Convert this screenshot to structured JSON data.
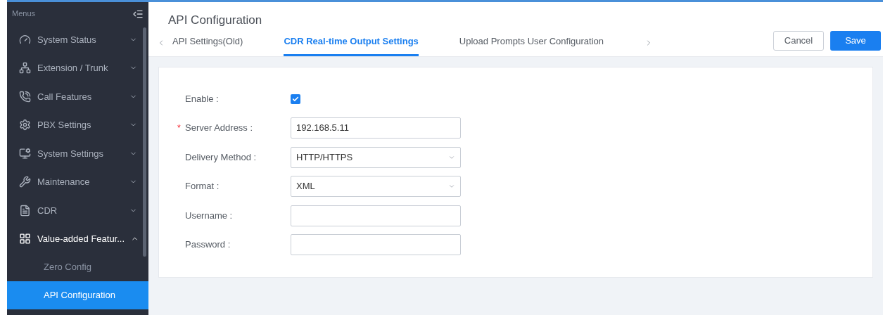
{
  "sidebar": {
    "title": "Menus",
    "items": [
      {
        "label": "System Status",
        "expanded": false
      },
      {
        "label": "Extension / Trunk",
        "expanded": false
      },
      {
        "label": "Call Features",
        "expanded": false
      },
      {
        "label": "PBX Settings",
        "expanded": false
      },
      {
        "label": "System Settings",
        "expanded": false
      },
      {
        "label": "Maintenance",
        "expanded": false
      },
      {
        "label": "CDR",
        "expanded": false
      },
      {
        "label": "Value-added Featur...",
        "expanded": true,
        "children": [
          {
            "label": "Zero Config",
            "selected": false
          },
          {
            "label": "API Configuration",
            "selected": true
          }
        ]
      }
    ]
  },
  "page": {
    "title": "API Configuration"
  },
  "tabs": [
    {
      "label": "API Settings(Old)",
      "selected": false
    },
    {
      "label": "CDR Real-time Output Settings",
      "selected": true
    },
    {
      "label": "Upload Prompts User Configuration",
      "selected": false
    }
  ],
  "buttons": [
    {
      "label": "Cancel",
      "kind": "secondary"
    },
    {
      "label": "Save",
      "kind": "primary"
    }
  ],
  "form": [
    {
      "label": "Enable :",
      "kind": "checkbox",
      "checked": true
    },
    {
      "label": "Server Address :",
      "kind": "text",
      "value": "192.168.5.11",
      "required_mark": "*"
    },
    {
      "label": "Delivery Method :",
      "kind": "select",
      "value": "HTTP/HTTPS"
    },
    {
      "label": "Format :",
      "kind": "select",
      "value": "XML"
    },
    {
      "label": "Username :",
      "kind": "text"
    },
    {
      "label": "Password :",
      "kind": "text"
    }
  ]
}
